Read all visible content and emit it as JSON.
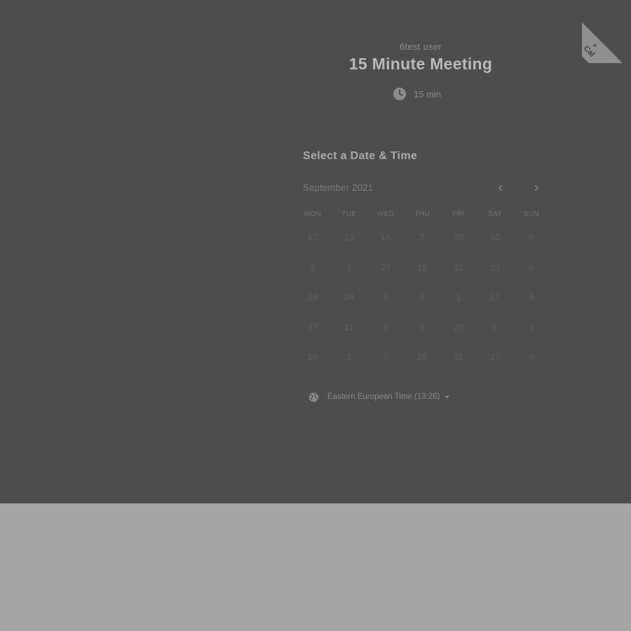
{
  "header": {
    "host_name": "6test user",
    "event_title": "15 Minute Meeting",
    "duration": "15 min"
  },
  "ribbon": {
    "line1": "P",
    "line2": "Cal"
  },
  "calendar": {
    "section_title": "Select a Date & Time",
    "month_label": "September 2021",
    "weekdays": [
      "MON",
      "TUE",
      "WED",
      "THU",
      "FRI",
      "SAT",
      "SUN"
    ],
    "weeks": [
      [
        "17",
        "23",
        "15",
        "7",
        "10",
        "30",
        "8"
      ],
      [
        "2",
        "1",
        "27",
        "15",
        "31",
        "13",
        "6"
      ],
      [
        "28",
        "24",
        "4",
        "5",
        "1",
        "27",
        "6"
      ],
      [
        "27",
        "11",
        "6",
        "6",
        "25",
        "6",
        "1"
      ],
      [
        "16",
        "2",
        "6",
        "26",
        "11",
        "17",
        "4"
      ]
    ]
  },
  "timezone": {
    "label": "Eastern European Time (13:26)"
  },
  "icons": {
    "duration": "clock-icon",
    "prev_month": "chevron-left-icon",
    "next_month": "chevron-right-icon",
    "timezone": "globe-icon",
    "timezone_dropdown": "caret-down-icon"
  },
  "colors": {
    "overlay_panel": "#4d4d4d",
    "page_background": "#a6a6a6",
    "ribbon": "#8f8f8f"
  }
}
